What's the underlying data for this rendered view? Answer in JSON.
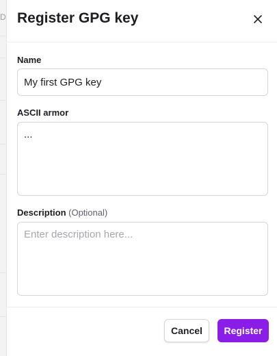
{
  "dialog": {
    "title": "Register GPG key",
    "close_icon": "close-icon"
  },
  "form": {
    "name": {
      "label": "Name",
      "value": "My first GPG key"
    },
    "ascii_armor": {
      "label": "ASCII armor",
      "value": "..."
    },
    "description": {
      "label": "Description",
      "optional_hint": "(Optional)",
      "value": "",
      "placeholder": "Enter description here..."
    }
  },
  "footer": {
    "cancel_label": "Cancel",
    "register_label": "Register"
  },
  "background": {
    "peek_text": "D"
  },
  "colors": {
    "accent": "#8a1ee8",
    "border": "#d4d4da",
    "text": "#1d1d22"
  }
}
